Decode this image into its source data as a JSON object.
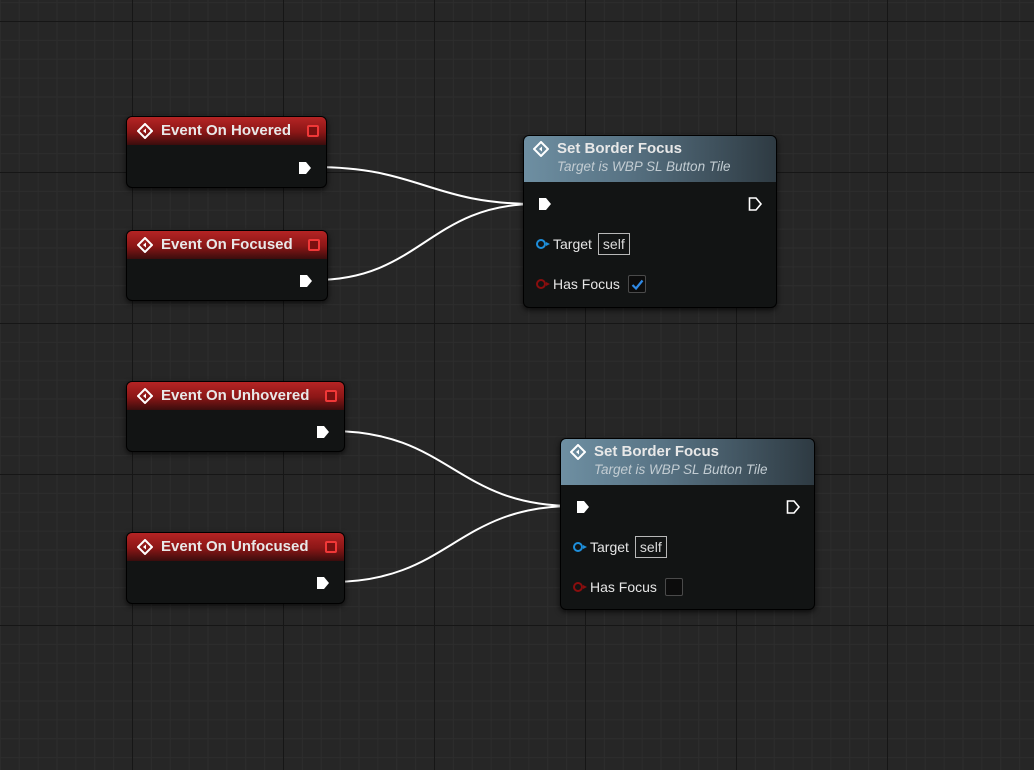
{
  "event_nodes": [
    {
      "title": "Event On Hovered"
    },
    {
      "title": "Event On Focused"
    },
    {
      "title": "Event On Unhovered"
    },
    {
      "title": "Event On Unfocused"
    }
  ],
  "function_nodes": [
    {
      "title": "Set Border Focus",
      "subtitle": "Target is WBP SL Button Tile",
      "target_label": "Target",
      "target_value": "self",
      "has_focus_label": "Has Focus",
      "has_focus_checked": true
    },
    {
      "title": "Set Border Focus",
      "subtitle": "Target is WBP SL Button Tile",
      "target_label": "Target",
      "target_value": "self",
      "has_focus_label": "Has Focus",
      "has_focus_checked": false
    }
  ],
  "icons": {
    "event": "event-diamond-icon",
    "function": "function-diamond-icon",
    "delegate": "delegate-pin-icon",
    "exec": "exec-pin-icon",
    "object_pin": "object-pin-icon",
    "bool_pin": "bool-pin-icon",
    "check": "checkmark-icon"
  },
  "colors": {
    "graph_bg": "#262626",
    "event_header": "#b52424",
    "function_header": "#6e8fa2",
    "object_pin": "#1e8fdc",
    "bool_pin": "#8a0e0e",
    "checkmark": "#2f8ae6",
    "wire": "#ffffff"
  }
}
